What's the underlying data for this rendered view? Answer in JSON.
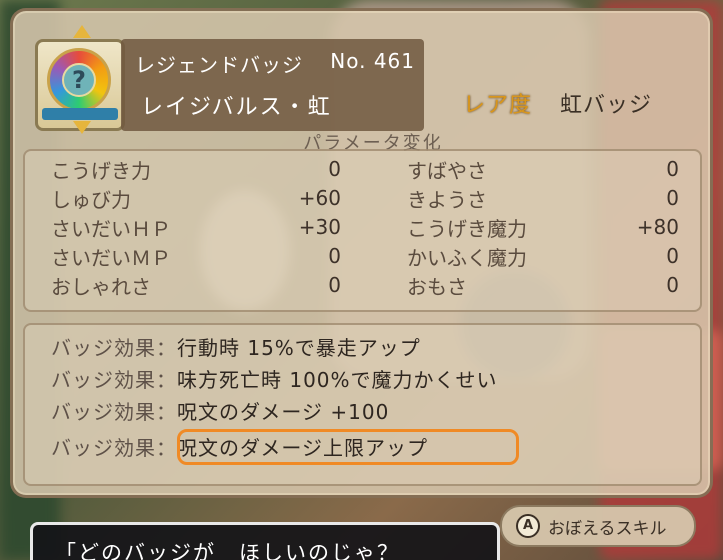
{
  "badge": {
    "category": "レジェンドバッジ",
    "number": "No. 461",
    "name": "レイジバルス・虹",
    "icon": "mystery-rainbow-medal-icon",
    "icon_glyph": "?"
  },
  "rarity": {
    "label": "レア度",
    "value": "虹バッジ"
  },
  "parameters": {
    "title": "パラメータ変化",
    "left": [
      {
        "name": "こうげき力",
        "value": "0"
      },
      {
        "name": "しゅび力",
        "value": "+60"
      },
      {
        "name": "さいだいＨＰ",
        "value": "+30"
      },
      {
        "name": "さいだいＭＰ",
        "value": "0"
      },
      {
        "name": "おしゃれさ",
        "value": "0"
      }
    ],
    "right": [
      {
        "name": "すばやさ",
        "value": "0"
      },
      {
        "name": "きようさ",
        "value": "0"
      },
      {
        "name": "こうげき魔力",
        "value": "+80"
      },
      {
        "name": "かいふく魔力",
        "value": "0"
      },
      {
        "name": "おもさ",
        "value": "0"
      }
    ]
  },
  "effects": [
    {
      "label": "バッジ効果：",
      "text": "行動時 15%で暴走アップ"
    },
    {
      "label": "バッジ効果：",
      "text": "味方死亡時 100%で魔力かくせい"
    },
    {
      "label": "バッジ効果：",
      "text": "呪文のダメージ +100"
    },
    {
      "label": "バッジ効果：",
      "text": "呪文のダメージ上限アップ"
    }
  ],
  "highlight_color": "#f08a25",
  "learn_button": {
    "icon_label": "A",
    "label": "おぼえるスキル"
  },
  "dialog": {
    "text": "「どのバッジが　ほしいのじゃ？"
  }
}
